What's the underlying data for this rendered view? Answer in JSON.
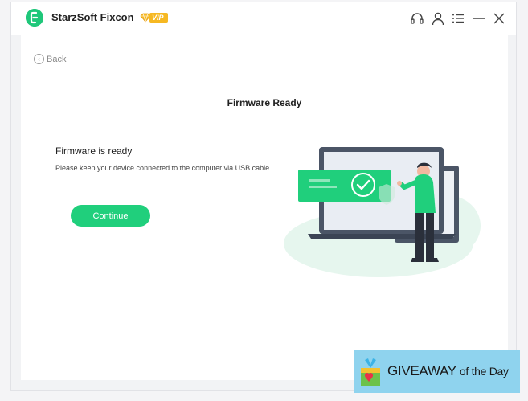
{
  "app": {
    "title": "StarzSoft Fixcon",
    "vip_label": "VIP"
  },
  "titlebar_icons": [
    "headset-icon",
    "user-icon",
    "menu-icon",
    "minimize-icon",
    "close-icon"
  ],
  "nav": {
    "back_label": "Back"
  },
  "page": {
    "title": "Firmware Ready",
    "heading": "Firmware is ready",
    "description": "Please keep your device connected to the computer via USB cable.",
    "continue_label": "Continue"
  },
  "watermark": {
    "main": "GIVEAWAY",
    "suffix": "of the Day"
  },
  "colors": {
    "accent": "#20cf7c",
    "vip": "#f6b822",
    "watermark_bg": "#8fd3ee"
  }
}
